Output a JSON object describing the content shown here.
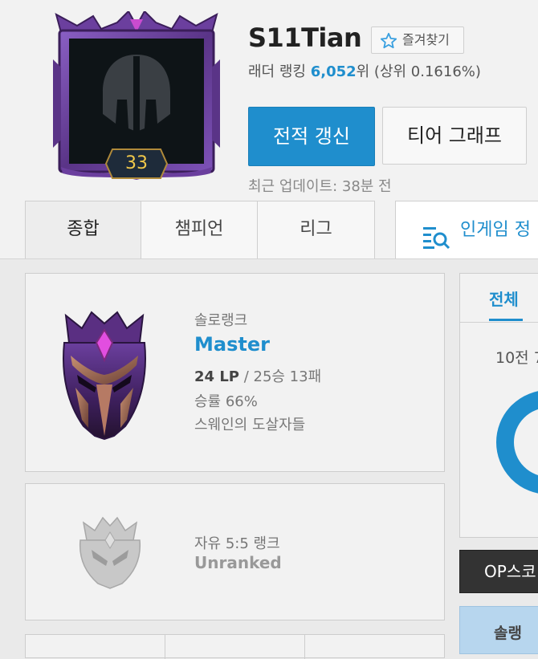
{
  "profile": {
    "level": "33",
    "name": "S11Tian",
    "favorite_label": "즐겨찾기",
    "ladder_prefix": "래더 랭킹",
    "ladder_rank": "6,052",
    "ladder_suffix": "위 (상위 0.1616%)",
    "refresh_label": "전적 갱신",
    "tier_graph_label": "티어 그래프",
    "last_update": "최근 업데이트: 38분 전"
  },
  "tabs": [
    {
      "label": "종합"
    },
    {
      "label": "챔피언"
    },
    {
      "label": "리그"
    }
  ],
  "ingame_tab": {
    "label": "인게임 정"
  },
  "solo_rank": {
    "queue": "솔로랭크",
    "tier": "Master",
    "lp": "24 LP",
    "record": " / 25승 13패",
    "winrate": "승률 66%",
    "league": "스웨인의 도살자들"
  },
  "flex_rank": {
    "queue": "자유 5:5 랭크",
    "tier": "Unranked"
  },
  "right_panel": {
    "tab_all": "전체",
    "summary": "10전 7",
    "op_score": "OP스코",
    "solo_label": "솔랭"
  },
  "colors": {
    "accent": "#1f8ecd",
    "background": "#eaeaea",
    "level_text": "#f1c84a"
  }
}
